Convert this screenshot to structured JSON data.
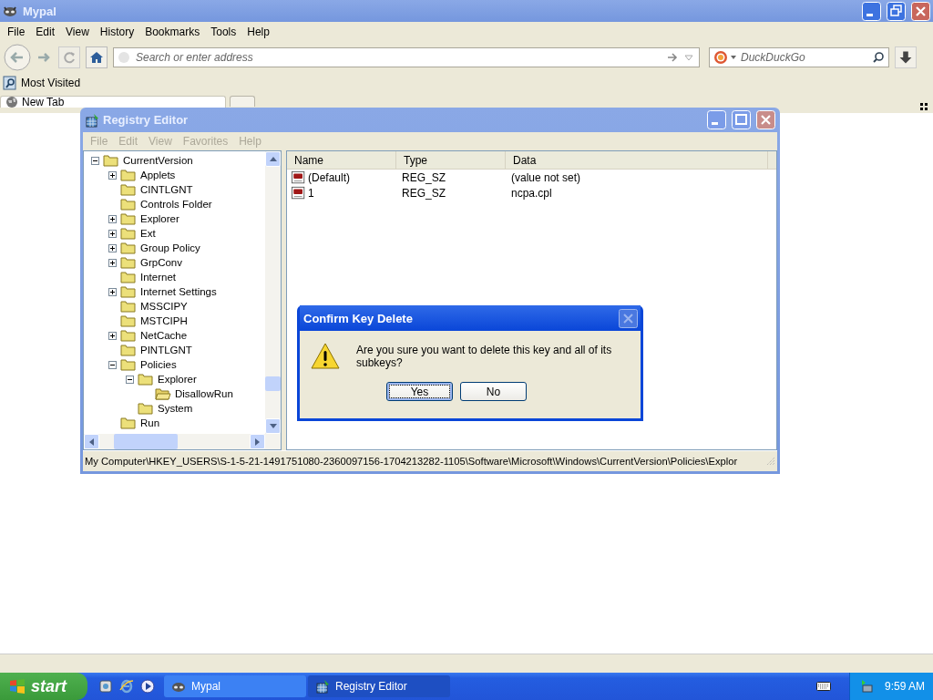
{
  "browser": {
    "title": "Mypal",
    "menu": [
      "File",
      "Edit",
      "View",
      "History",
      "Bookmarks",
      "Tools",
      "Help"
    ],
    "address": {
      "placeholder": "Search or enter address"
    },
    "search": {
      "placeholder": "DuckDuckGo"
    },
    "bookmarks": [
      "Most Visited"
    ],
    "tabs": [
      {
        "label": "New Tab",
        "selected": true
      }
    ]
  },
  "regedit": {
    "title": "Registry Editor",
    "menu": [
      {
        "label": "File",
        "disabled": true
      },
      {
        "label": "Edit",
        "disabled": true
      },
      {
        "label": "View",
        "disabled": true
      },
      {
        "label": "Favorites",
        "disabled": true
      },
      {
        "label": "Help",
        "disabled": true
      }
    ],
    "tree": [
      {
        "label": "CurrentVersion",
        "kind": "expanded",
        "selected": false,
        "children": [
          {
            "label": "Applets",
            "kind": "collapsed",
            "selected": false
          },
          {
            "label": "CINTLGNT",
            "kind": "leaf",
            "selected": false
          },
          {
            "label": "Controls Folder",
            "kind": "leaf",
            "selected": false
          },
          {
            "label": "Explorer",
            "kind": "collapsed",
            "selected": false
          },
          {
            "label": "Ext",
            "kind": "collapsed",
            "selected": false
          },
          {
            "label": "Group Policy",
            "kind": "collapsed",
            "selected": false
          },
          {
            "label": "GrpConv",
            "kind": "collapsed",
            "selected": false
          },
          {
            "label": "Internet",
            "kind": "leaf",
            "selected": false
          },
          {
            "label": "Internet Settings",
            "kind": "collapsed",
            "selected": false
          },
          {
            "label": "MSSCIPY",
            "kind": "leaf",
            "selected": false
          },
          {
            "label": "MSTCIPH",
            "kind": "leaf",
            "selected": false
          },
          {
            "label": "NetCache",
            "kind": "collapsed",
            "selected": false
          },
          {
            "label": "PINTLGNT",
            "kind": "leaf",
            "selected": false
          },
          {
            "label": "Policies",
            "kind": "expanded",
            "selected": false,
            "children": [
              {
                "label": "Explorer",
                "kind": "expanded",
                "selected": false,
                "children": [
                  {
                    "label": "DisallowRun",
                    "kind": "leaf",
                    "selected": true
                  }
                ]
              },
              {
                "label": "System",
                "kind": "leaf",
                "selected": false
              }
            ]
          },
          {
            "label": "Run",
            "kind": "leaf",
            "selected": false
          }
        ]
      }
    ],
    "columns": [
      "Name",
      "Type",
      "Data"
    ],
    "rows": [
      {
        "name": "(Default)",
        "type": "REG_SZ",
        "data": "(value not set)"
      },
      {
        "name": "1",
        "type": "REG_SZ",
        "data": "ncpa.cpl"
      }
    ],
    "status": "My Computer\\HKEY_USERS\\S-1-5-21-1491751080-2360097156-1704213282-1105\\Software\\Microsoft\\Windows\\CurrentVersion\\Policies\\Explor"
  },
  "dialog": {
    "title": "Confirm Key Delete",
    "message": "Are you sure you want to delete this key and all of its subkeys?",
    "buttons": [
      {
        "label": "Yes",
        "selected": true
      },
      {
        "label": "No",
        "selected": false
      }
    ]
  },
  "taskbar": {
    "start": "start",
    "tasks": [
      {
        "label": "Mypal",
        "selected": false
      },
      {
        "label": "Registry Editor",
        "selected": true
      }
    ],
    "clock": "9:59 AM"
  }
}
